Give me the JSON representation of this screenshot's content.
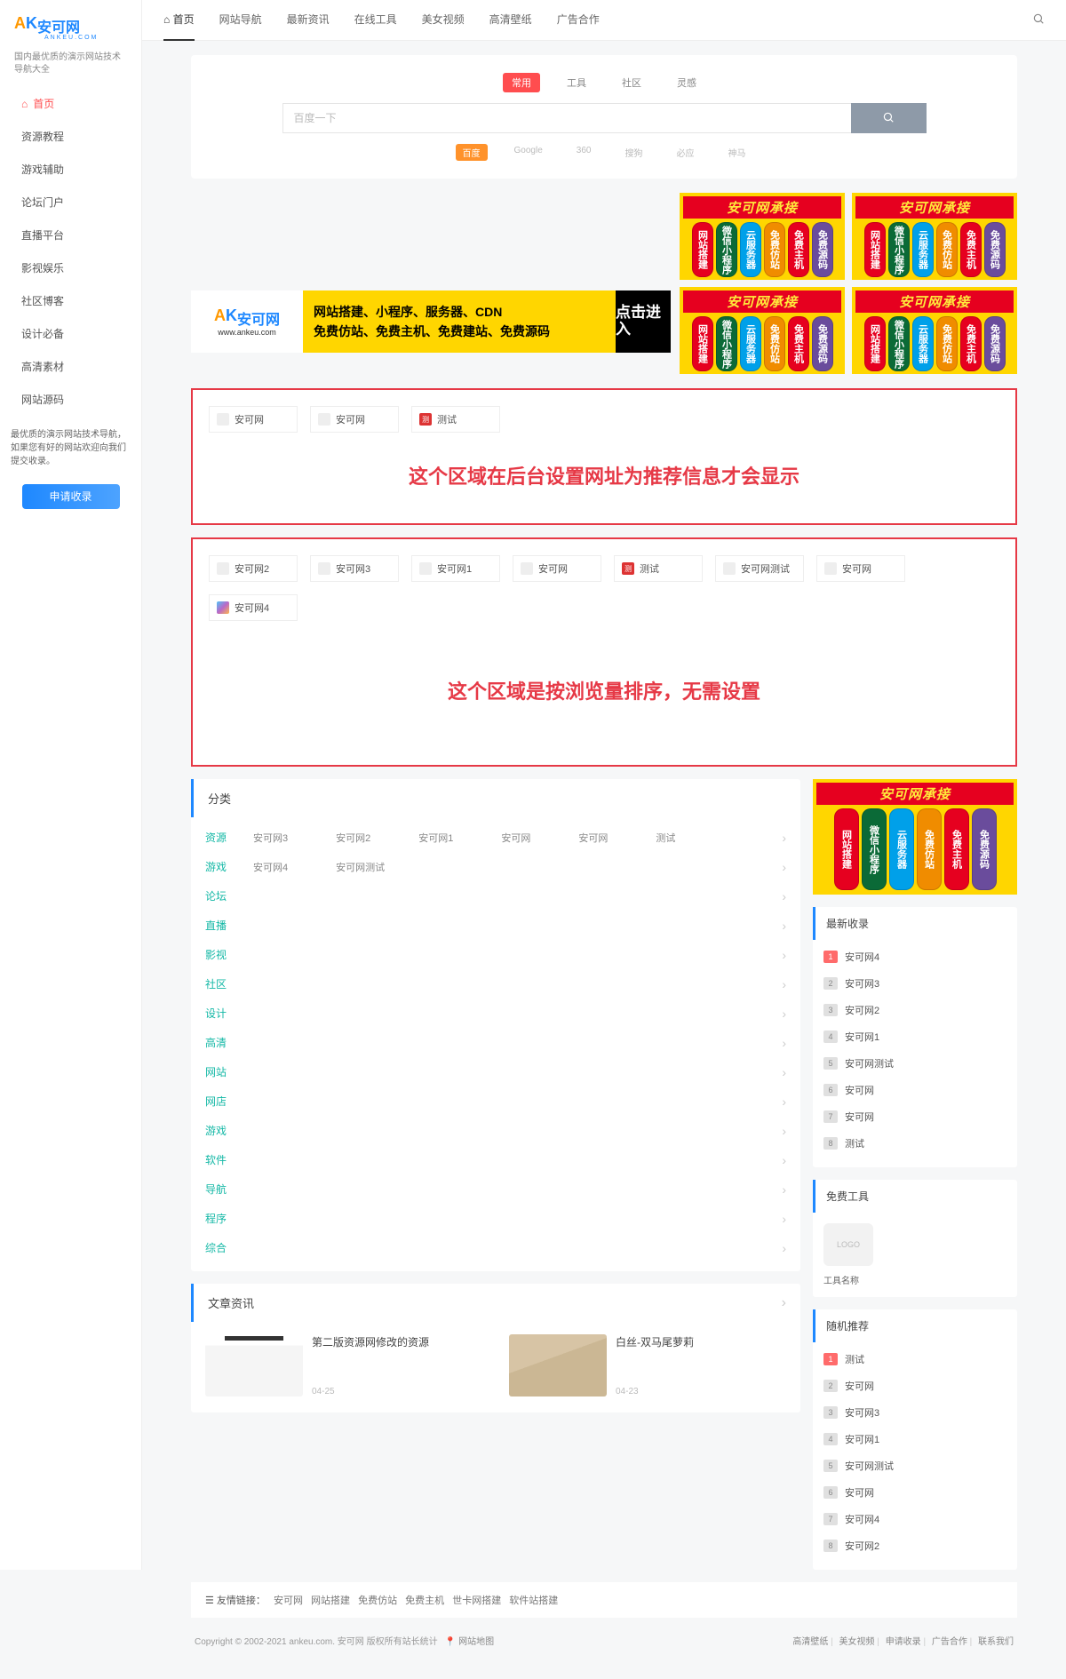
{
  "site": {
    "logo_a": "A",
    "logo_k": "K",
    "name_cn": "安可网",
    "domain": "ANKEU.COM",
    "slogan": "国内最优质的演示网站技术导航大全"
  },
  "sidebar": {
    "items": [
      "首页",
      "资源教程",
      "游戏辅助",
      "论坛门户",
      "直播平台",
      "影视娱乐",
      "社区博客",
      "设计必备",
      "高清素材",
      "网站源码"
    ],
    "note": "最优质的演示网站技术导航，如果您有好的网站欢迎向我们提交收录。",
    "apply": "申请收录"
  },
  "topnav": [
    "首页",
    "网站导航",
    "最新资讯",
    "在线工具",
    "美女视频",
    "高清壁纸",
    "广告合作"
  ],
  "search": {
    "tabs": [
      "常用",
      "工具",
      "社区",
      "灵感"
    ],
    "placeholder": "百度一下",
    "engines": [
      "百度",
      "Google",
      "360",
      "搜狗",
      "必应",
      "神马"
    ]
  },
  "banner": {
    "url": "www.ankeu.com",
    "line1": "网站搭建、小程序、服务器、CDN",
    "line2": "免费仿站、免费主机、免费建站、免费源码",
    "click": "点击进入"
  },
  "adTile": {
    "head": "安可网承接",
    "pills": [
      "网站搭建",
      "微信小程序",
      "云服务器",
      "免费仿站",
      "免费主机",
      "免费源码"
    ]
  },
  "box1": {
    "items": [
      {
        "t": "安可网"
      },
      {
        "t": "安可网"
      },
      {
        "t": "测试",
        "red": true
      }
    ],
    "caption": "这个区域在后台设置网址为推荐信息才会显示"
  },
  "box2": {
    "items": [
      {
        "t": "安可网2"
      },
      {
        "t": "安可网3"
      },
      {
        "t": "安可网1"
      },
      {
        "t": "安可网"
      },
      {
        "t": "测试",
        "red": true
      },
      {
        "t": "安可网测试"
      },
      {
        "t": "安可网"
      },
      {
        "t": "安可网4",
        "clr": true
      }
    ],
    "caption": "这个区域是按浏览量排序，无需设置"
  },
  "category": {
    "title": "分类",
    "rows": [
      {
        "name": "资源",
        "sub": [
          "安可网3",
          "安可网2",
          "安可网1",
          "安可网",
          "安可网",
          "测试"
        ],
        "arrow": true
      },
      {
        "name": "游戏",
        "sub": [
          "安可网4",
          "安可网测试"
        ],
        "arrow": true
      },
      {
        "name": "论坛",
        "sub": [],
        "arrow": true
      },
      {
        "name": "直播",
        "sub": [],
        "arrow": true
      },
      {
        "name": "影视",
        "sub": [],
        "arrow": true
      },
      {
        "name": "社区",
        "sub": [],
        "arrow": true
      },
      {
        "name": "设计",
        "sub": [],
        "arrow": true
      },
      {
        "name": "高清",
        "sub": [],
        "arrow": true
      },
      {
        "name": "网站",
        "sub": [],
        "arrow": true
      },
      {
        "name": "网店",
        "sub": [],
        "arrow": true
      },
      {
        "name": "游戏",
        "sub": [],
        "arrow": true
      },
      {
        "name": "软件",
        "sub": [],
        "arrow": true
      },
      {
        "name": "导航",
        "sub": [],
        "arrow": true
      },
      {
        "name": "程序",
        "sub": [],
        "arrow": true
      },
      {
        "name": "综合",
        "sub": [],
        "arrow": true
      }
    ]
  },
  "articles": {
    "title": "文章资讯",
    "items": [
      {
        "title": "第二版资源网修改的资源",
        "date": "04-25"
      },
      {
        "title": "白丝-双马尾萝莉",
        "date": "04-23"
      }
    ]
  },
  "latest": {
    "title": "最新收录",
    "items": [
      "安可网4",
      "安可网3",
      "安可网2",
      "安可网1",
      "安可网测试",
      "安可网",
      "安可网",
      "测试"
    ]
  },
  "tools": {
    "title": "免费工具",
    "icon": "LOGO",
    "name": "工具名称"
  },
  "random": {
    "title": "随机推荐",
    "items": [
      "测试",
      "安可网",
      "安可网3",
      "安可网1",
      "安可网测试",
      "安可网",
      "安可网4",
      "安可网2"
    ]
  },
  "friends": {
    "label": "友情链接：",
    "links": [
      "安可网",
      "网站搭建",
      "免费仿站",
      "免费主机",
      "世卡网搭建",
      "软件站搭建"
    ]
  },
  "footer": {
    "left": "Copyright © 2002-2021 ankeu.com. 安可网 版权所有站长统计",
    "map": "网站地图",
    "right": [
      "高清壁纸",
      "美女视频",
      "申请收录",
      "广告合作",
      "联系我们"
    ]
  }
}
